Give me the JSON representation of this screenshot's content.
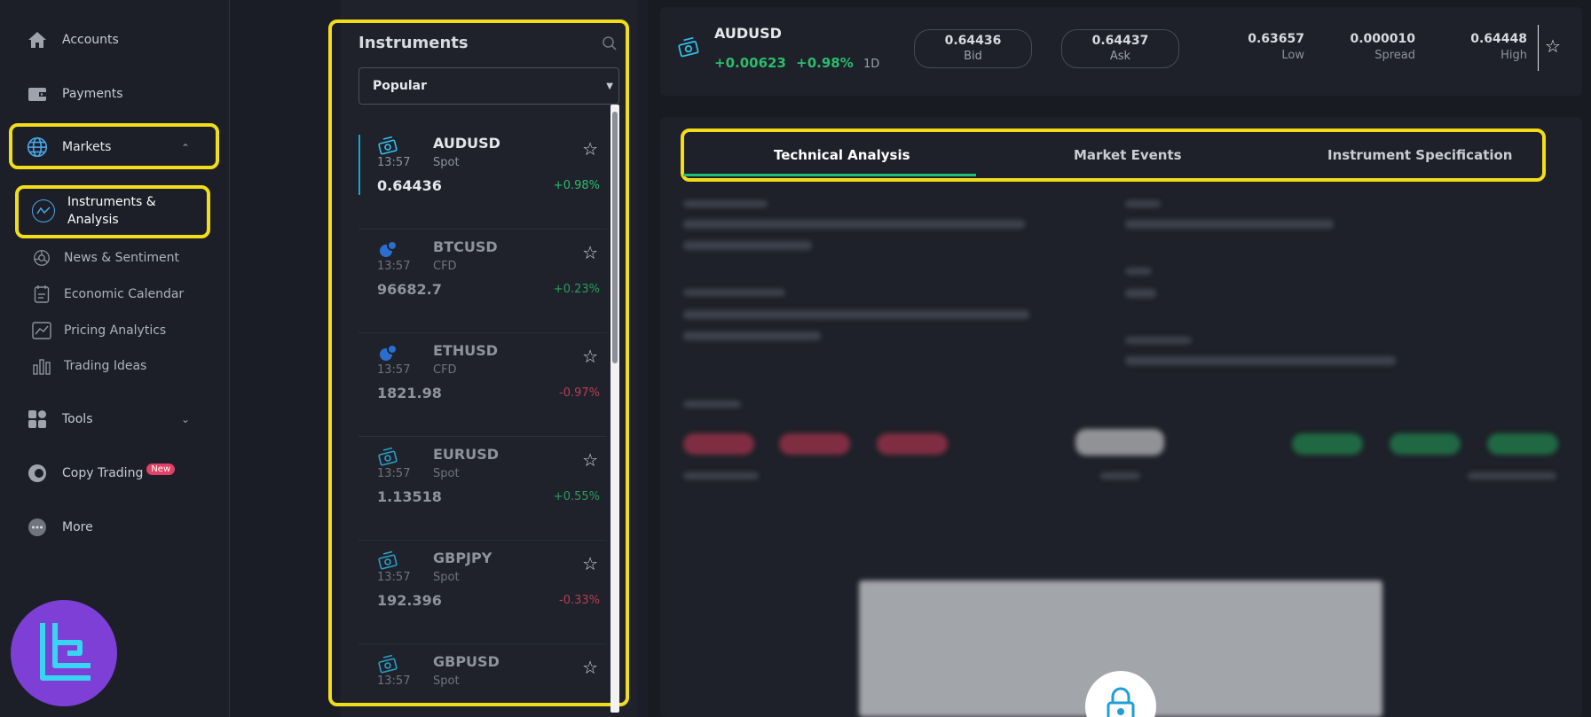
{
  "sidebar": {
    "items": [
      {
        "label": "Accounts"
      },
      {
        "label": "Payments"
      },
      {
        "label": "Markets"
      },
      {
        "label": "Tools"
      },
      {
        "label": "Copy Trading",
        "badge": "New"
      },
      {
        "label": "More"
      }
    ],
    "sub_items": [
      {
        "label": "Instruments & Analysis"
      },
      {
        "label": "News & Sentiment"
      },
      {
        "label": "Economic Calendar"
      },
      {
        "label": "Pricing Analytics"
      },
      {
        "label": "Trading Ideas"
      }
    ]
  },
  "instruments": {
    "title": "Instruments",
    "filter": "Popular",
    "rows": [
      {
        "symbol": "AUDUSD",
        "time": "13:57",
        "type": "Spot",
        "price": "0.64436",
        "change": "+0.98%"
      },
      {
        "symbol": "BTCUSD",
        "time": "13:57",
        "type": "CFD",
        "price": "96682.7",
        "change": "+0.23%"
      },
      {
        "symbol": "ETHUSD",
        "time": "13:57",
        "type": "CFD",
        "price": "1821.98",
        "change": "-0.97%"
      },
      {
        "symbol": "EURUSD",
        "time": "13:57",
        "type": "Spot",
        "price": "1.13518",
        "change": "+0.55%"
      },
      {
        "symbol": "GBPJPY",
        "time": "13:57",
        "type": "Spot",
        "price": "192.396",
        "change": "-0.33%"
      },
      {
        "symbol": "GBPUSD",
        "time": "13:57",
        "type": "Spot",
        "price": "",
        "change": ""
      }
    ]
  },
  "quote": {
    "symbol": "AUDUSD",
    "change_abs": "+0.00623",
    "change_pct": "+0.98%",
    "timeframe": "1D",
    "bid": {
      "value": "0.64436",
      "label": "Bid"
    },
    "ask": {
      "value": "0.64437",
      "label": "Ask"
    },
    "low": {
      "value": "0.63657",
      "label": "Low"
    },
    "spread": {
      "value": "0.000010",
      "label": "Spread"
    },
    "high": {
      "value": "0.64448",
      "label": "High"
    }
  },
  "tabs": [
    {
      "label": "Technical Analysis"
    },
    {
      "label": "Market Events"
    },
    {
      "label": "Instrument Specification"
    }
  ],
  "colors": {
    "highlight": "#f2dd1a",
    "accent_green": "#2bbd6e",
    "accent_red": "#e04a5c",
    "accent_blue": "#1e9fd8",
    "logo_purple": "#7d3fd6"
  }
}
